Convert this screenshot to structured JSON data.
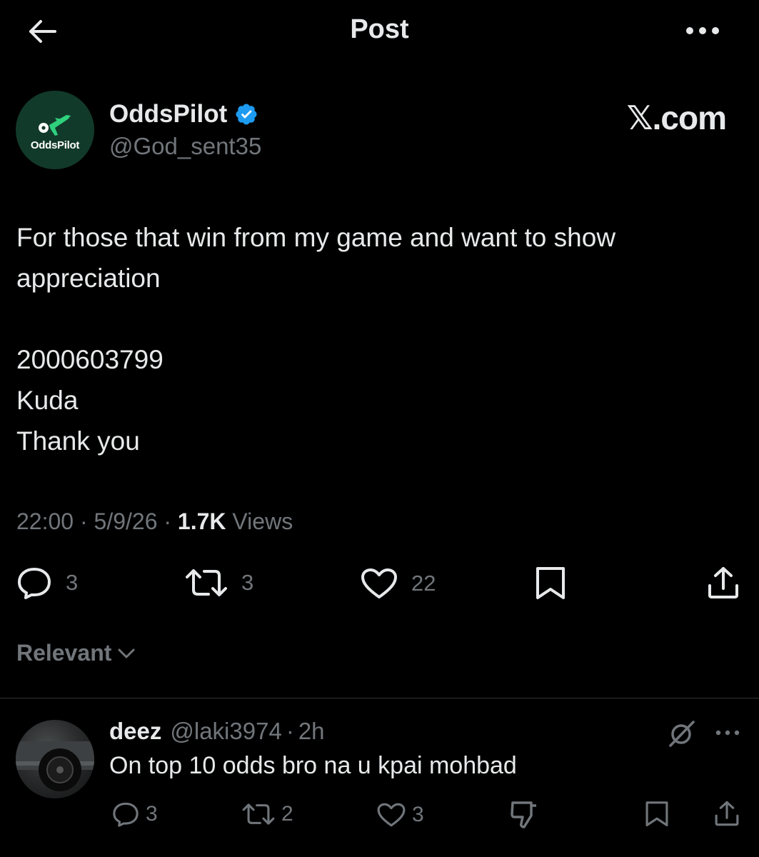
{
  "header": {
    "title": "Post"
  },
  "author": {
    "name": "OddsPilot",
    "handle": "@God_sent35",
    "avatar_text": "OddsPilot",
    "verified_color": "#1d9bf0",
    "avatar_bg": "#123a2b",
    "avatar_plane_color": "#2fd17d"
  },
  "watermark": "𝕏.com",
  "post": {
    "lines": [
      "For those that win from my game and want to show",
      "appreciation",
      "",
      "2000603799",
      "Kuda",
      "Thank you"
    ]
  },
  "meta": {
    "time": "22:00",
    "sep": " · ",
    "date": "5/9/26",
    "views_count": "1.7K",
    "views_label": "Views"
  },
  "actions": {
    "replies": "3",
    "reposts": "3",
    "likes": "22"
  },
  "sort": {
    "label": "Relevant"
  },
  "reply": {
    "name": "deez",
    "handle": "@laki3974",
    "time": "2h",
    "sep": "·",
    "text": "On top 10 odds bro na u kpai mohbad",
    "replies": "3",
    "reposts": "2",
    "likes": "3"
  },
  "colors": {
    "background": "#000000",
    "text": "#e7e9ea",
    "muted": "#71767b",
    "divider": "#2f3336"
  }
}
